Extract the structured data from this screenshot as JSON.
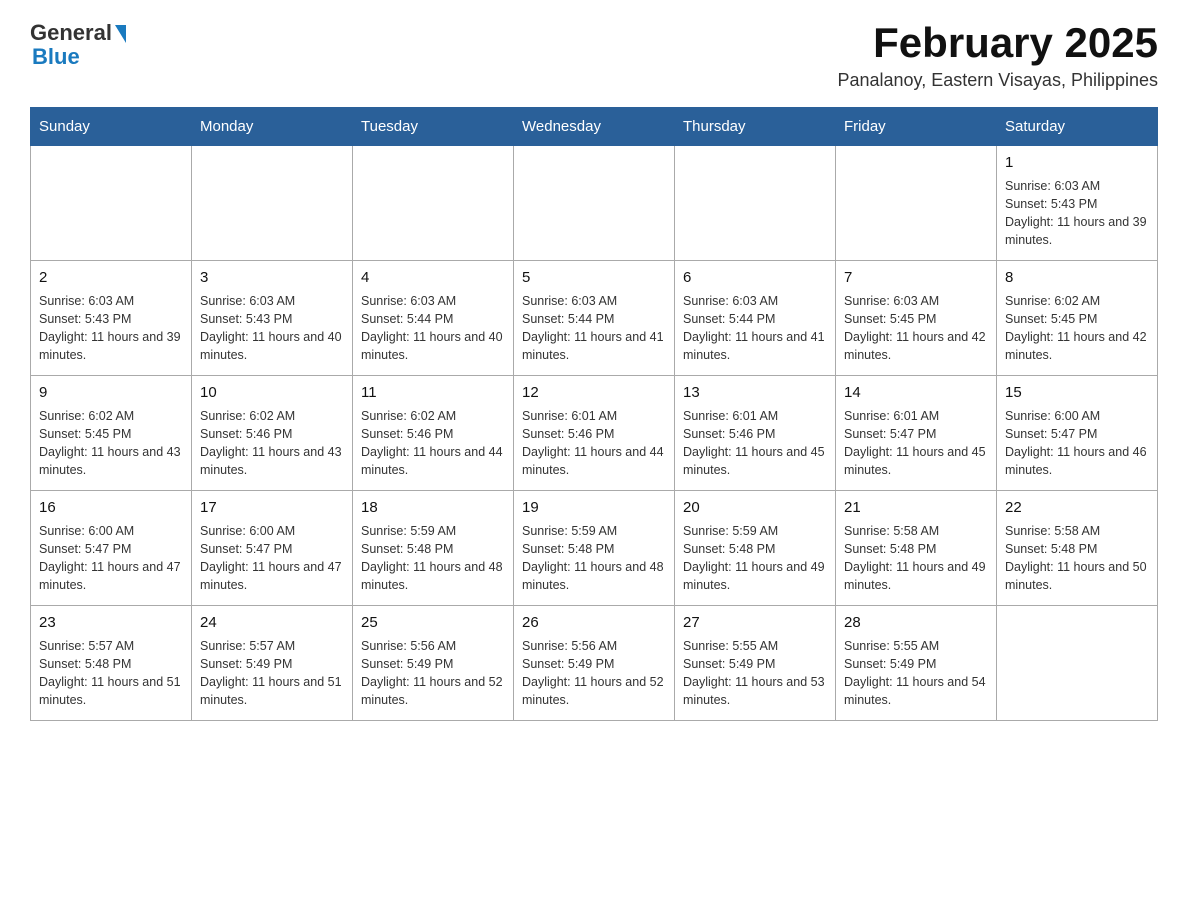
{
  "header": {
    "logo_general": "General",
    "logo_blue": "Blue",
    "title": "February 2025",
    "subtitle": "Panalanoy, Eastern Visayas, Philippines"
  },
  "days_of_week": [
    "Sunday",
    "Monday",
    "Tuesday",
    "Wednesday",
    "Thursday",
    "Friday",
    "Saturday"
  ],
  "weeks": [
    {
      "days": [
        {
          "num": "",
          "info": ""
        },
        {
          "num": "",
          "info": ""
        },
        {
          "num": "",
          "info": ""
        },
        {
          "num": "",
          "info": ""
        },
        {
          "num": "",
          "info": ""
        },
        {
          "num": "",
          "info": ""
        },
        {
          "num": "1",
          "info": "Sunrise: 6:03 AM\nSunset: 5:43 PM\nDaylight: 11 hours and 39 minutes."
        }
      ]
    },
    {
      "days": [
        {
          "num": "2",
          "info": "Sunrise: 6:03 AM\nSunset: 5:43 PM\nDaylight: 11 hours and 39 minutes."
        },
        {
          "num": "3",
          "info": "Sunrise: 6:03 AM\nSunset: 5:43 PM\nDaylight: 11 hours and 40 minutes."
        },
        {
          "num": "4",
          "info": "Sunrise: 6:03 AM\nSunset: 5:44 PM\nDaylight: 11 hours and 40 minutes."
        },
        {
          "num": "5",
          "info": "Sunrise: 6:03 AM\nSunset: 5:44 PM\nDaylight: 11 hours and 41 minutes."
        },
        {
          "num": "6",
          "info": "Sunrise: 6:03 AM\nSunset: 5:44 PM\nDaylight: 11 hours and 41 minutes."
        },
        {
          "num": "7",
          "info": "Sunrise: 6:03 AM\nSunset: 5:45 PM\nDaylight: 11 hours and 42 minutes."
        },
        {
          "num": "8",
          "info": "Sunrise: 6:02 AM\nSunset: 5:45 PM\nDaylight: 11 hours and 42 minutes."
        }
      ]
    },
    {
      "days": [
        {
          "num": "9",
          "info": "Sunrise: 6:02 AM\nSunset: 5:45 PM\nDaylight: 11 hours and 43 minutes."
        },
        {
          "num": "10",
          "info": "Sunrise: 6:02 AM\nSunset: 5:46 PM\nDaylight: 11 hours and 43 minutes."
        },
        {
          "num": "11",
          "info": "Sunrise: 6:02 AM\nSunset: 5:46 PM\nDaylight: 11 hours and 44 minutes."
        },
        {
          "num": "12",
          "info": "Sunrise: 6:01 AM\nSunset: 5:46 PM\nDaylight: 11 hours and 44 minutes."
        },
        {
          "num": "13",
          "info": "Sunrise: 6:01 AM\nSunset: 5:46 PM\nDaylight: 11 hours and 45 minutes."
        },
        {
          "num": "14",
          "info": "Sunrise: 6:01 AM\nSunset: 5:47 PM\nDaylight: 11 hours and 45 minutes."
        },
        {
          "num": "15",
          "info": "Sunrise: 6:00 AM\nSunset: 5:47 PM\nDaylight: 11 hours and 46 minutes."
        }
      ]
    },
    {
      "days": [
        {
          "num": "16",
          "info": "Sunrise: 6:00 AM\nSunset: 5:47 PM\nDaylight: 11 hours and 47 minutes."
        },
        {
          "num": "17",
          "info": "Sunrise: 6:00 AM\nSunset: 5:47 PM\nDaylight: 11 hours and 47 minutes."
        },
        {
          "num": "18",
          "info": "Sunrise: 5:59 AM\nSunset: 5:48 PM\nDaylight: 11 hours and 48 minutes."
        },
        {
          "num": "19",
          "info": "Sunrise: 5:59 AM\nSunset: 5:48 PM\nDaylight: 11 hours and 48 minutes."
        },
        {
          "num": "20",
          "info": "Sunrise: 5:59 AM\nSunset: 5:48 PM\nDaylight: 11 hours and 49 minutes."
        },
        {
          "num": "21",
          "info": "Sunrise: 5:58 AM\nSunset: 5:48 PM\nDaylight: 11 hours and 49 minutes."
        },
        {
          "num": "22",
          "info": "Sunrise: 5:58 AM\nSunset: 5:48 PM\nDaylight: 11 hours and 50 minutes."
        }
      ]
    },
    {
      "days": [
        {
          "num": "23",
          "info": "Sunrise: 5:57 AM\nSunset: 5:48 PM\nDaylight: 11 hours and 51 minutes."
        },
        {
          "num": "24",
          "info": "Sunrise: 5:57 AM\nSunset: 5:49 PM\nDaylight: 11 hours and 51 minutes."
        },
        {
          "num": "25",
          "info": "Sunrise: 5:56 AM\nSunset: 5:49 PM\nDaylight: 11 hours and 52 minutes."
        },
        {
          "num": "26",
          "info": "Sunrise: 5:56 AM\nSunset: 5:49 PM\nDaylight: 11 hours and 52 minutes."
        },
        {
          "num": "27",
          "info": "Sunrise: 5:55 AM\nSunset: 5:49 PM\nDaylight: 11 hours and 53 minutes."
        },
        {
          "num": "28",
          "info": "Sunrise: 5:55 AM\nSunset: 5:49 PM\nDaylight: 11 hours and 54 minutes."
        },
        {
          "num": "",
          "info": ""
        }
      ]
    }
  ]
}
